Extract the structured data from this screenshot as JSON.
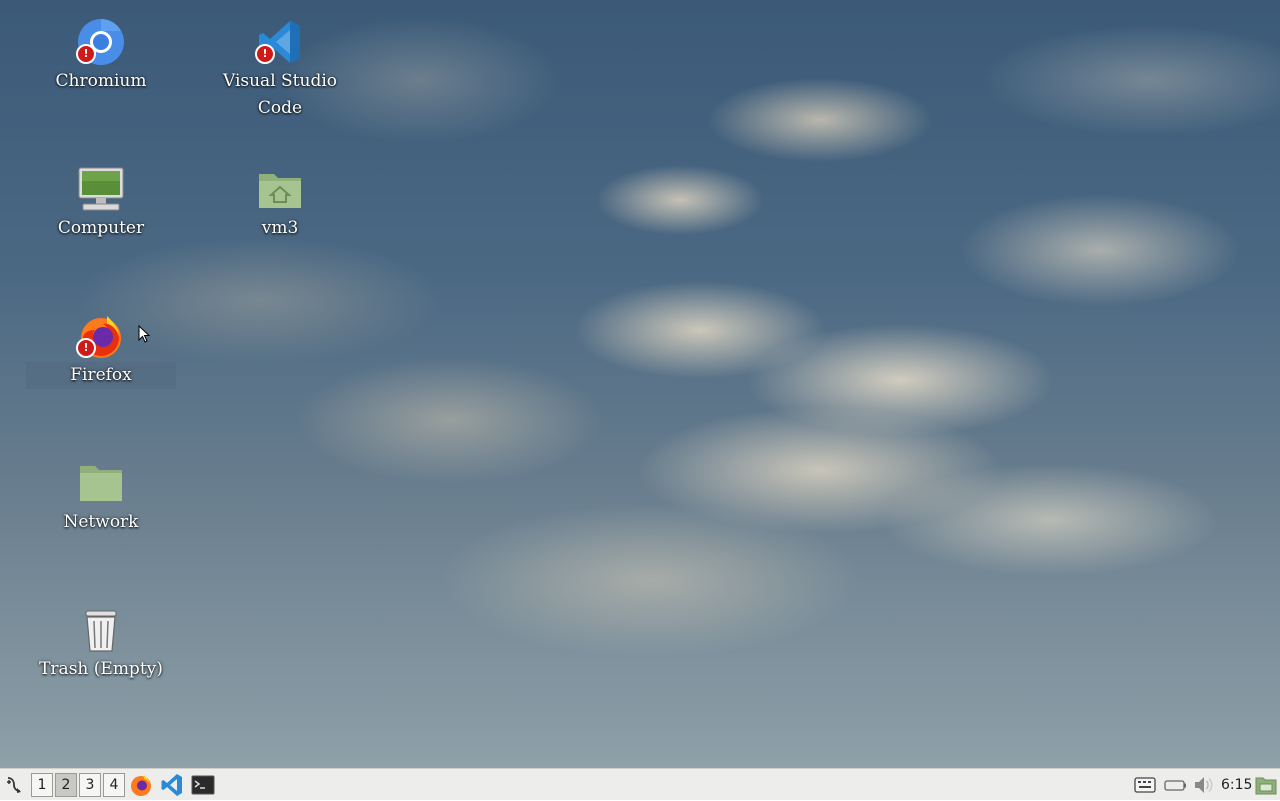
{
  "desktop": {
    "icons": [
      {
        "label": "Chromium",
        "icon": "chromium-icon"
      },
      {
        "label": "Visual Studio Code",
        "icon": "vscode-icon"
      },
      {
        "label": "Computer",
        "icon": "computer-icon"
      },
      {
        "label": "vm3",
        "icon": "home-folder-icon"
      },
      {
        "label": "Firefox",
        "icon": "firefox-icon"
      },
      {
        "label": "Network",
        "icon": "network-folder-icon"
      },
      {
        "label": "Trash (Empty)",
        "icon": "trash-icon"
      }
    ],
    "warning_badge": "!"
  },
  "taskbar": {
    "menu_icon": "app-menu-icon",
    "workspaces": [
      "1",
      "2",
      "3",
      "4"
    ],
    "active_workspace": "2",
    "launchers": [
      "firefox-icon",
      "vscode-icon",
      "terminal-icon"
    ],
    "tray": [
      "keyboard-layout-icon",
      "battery-icon",
      "volume-icon"
    ],
    "clock": "6:15",
    "show_desktop_icon": "show-desktop-icon"
  }
}
